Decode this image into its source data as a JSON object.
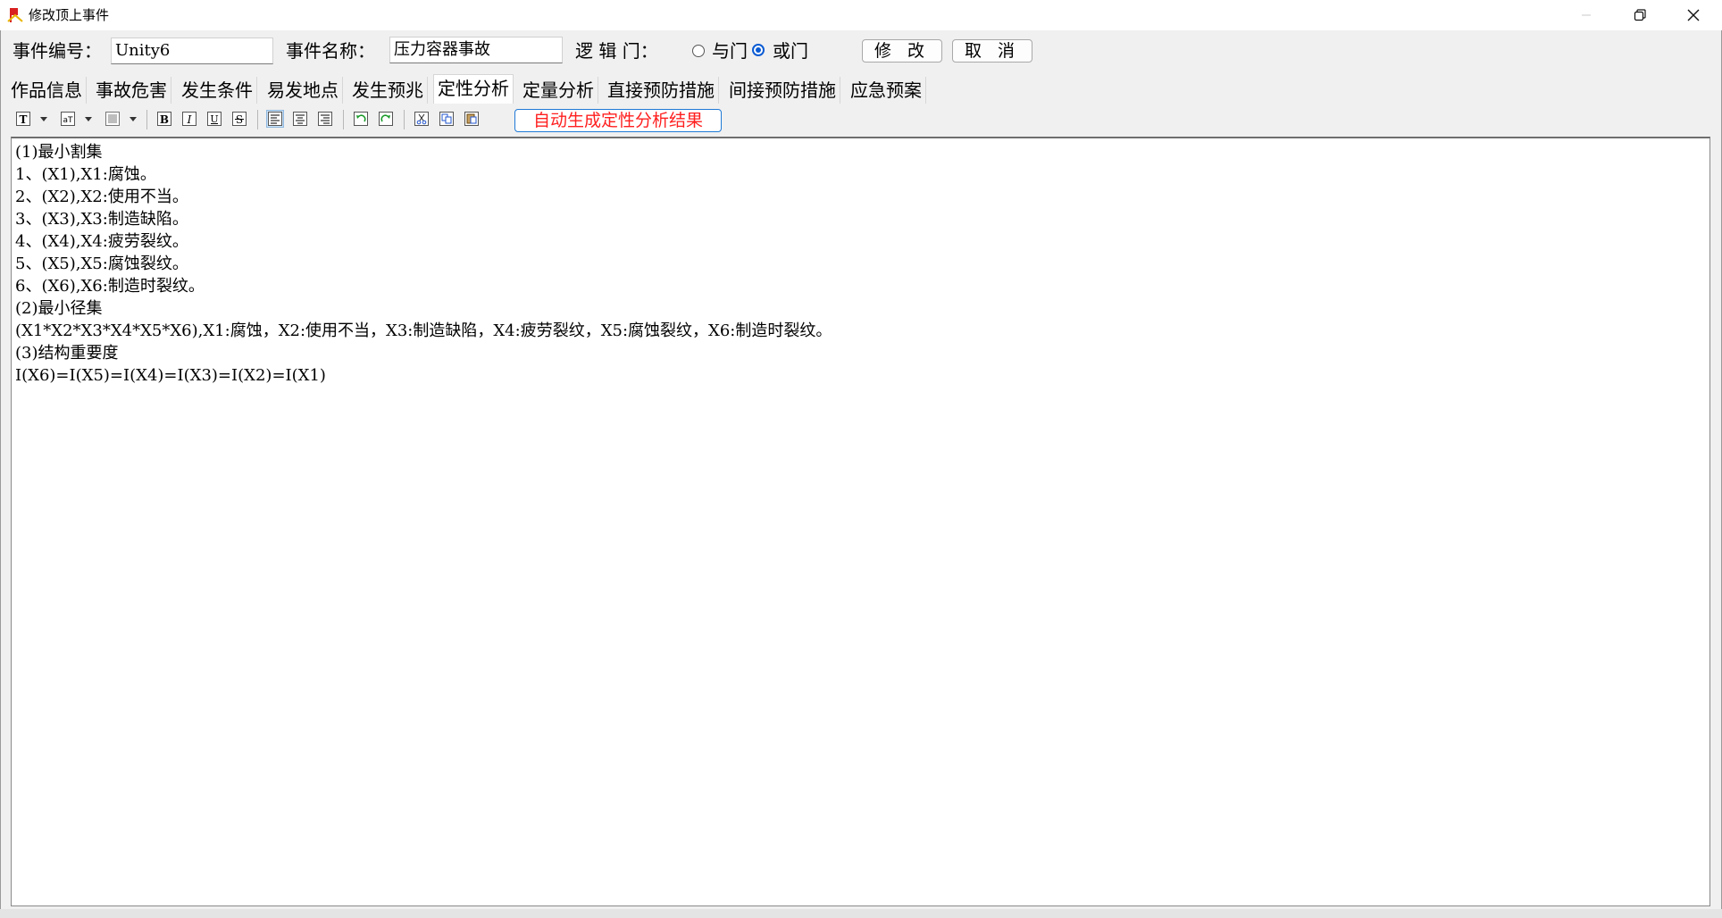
{
  "window": {
    "title": "修改顶上事件",
    "controls": [
      "minimize-icon",
      "restore-icon",
      "close-icon"
    ]
  },
  "header": {
    "event_id_label": "事件编号：",
    "event_id_value": "Unity6",
    "event_name_label": "事件名称：",
    "event_name_value": "压力容器事故",
    "logic_gate_label": "逻 辑 门：",
    "gate_options": [
      "与门",
      "或门"
    ],
    "selected_gate": "或门",
    "modify_button": "修 改",
    "cancel_button": "取 消"
  },
  "tabs": [
    {
      "label": "作品信息",
      "active": false
    },
    {
      "label": "事故危害",
      "active": false
    },
    {
      "label": "发生条件",
      "active": false
    },
    {
      "label": "易发地点",
      "active": false
    },
    {
      "label": "发生预兆",
      "active": false
    },
    {
      "label": "定性分析",
      "active": true
    },
    {
      "label": "定量分析",
      "active": false
    },
    {
      "label": "直接预防措施",
      "active": false
    },
    {
      "label": "间接预防措施",
      "active": false
    },
    {
      "label": "应急预案",
      "active": false
    }
  ],
  "toolbar": {
    "icons": [
      "font-icon",
      "font-size-icon",
      "color-icon",
      "bold-icon",
      "italic-icon",
      "underline-icon",
      "strikethrough-icon",
      "align-left-icon",
      "align-center-icon",
      "align-right-icon",
      "undo-icon",
      "redo-icon",
      "cut-icon",
      "copy-icon",
      "paste-icon"
    ],
    "auto_generate_button": "自动生成定性分析结果",
    "accent_color": "#ff1f1f"
  },
  "editor": {
    "lines": [
      "(1)最小割集",
      "1、(X1),X1:腐蚀。",
      "2、(X2),X2:使用不当。",
      "3、(X3),X3:制造缺陷。",
      "4、(X4),X4:疲劳裂纹。",
      "5、(X5),X5:腐蚀裂纹。",
      "6、(X6),X6:制造时裂纹。",
      "(2)最小径集",
      "(X1*X2*X3*X4*X5*X6),X1:腐蚀，X2:使用不当，X3:制造缺陷，X4:疲劳裂纹，X5:腐蚀裂纹，X6:制造时裂纹。",
      "(3)结构重要度",
      "I(X6)=I(X5)=I(X4)=I(X3)=I(X2)=I(X1)"
    ]
  }
}
